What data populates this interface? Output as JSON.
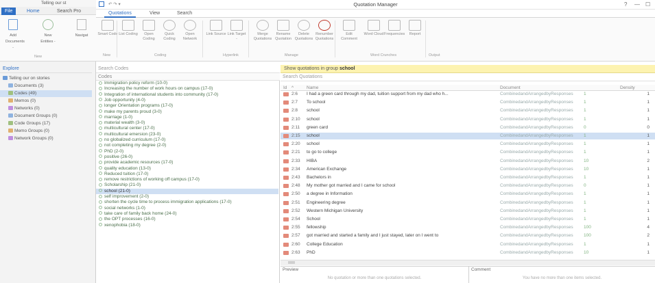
{
  "background_app": {
    "tab_label": "Telling our st",
    "tabs": [
      "File",
      "Home",
      "Search Pro"
    ],
    "ribbon_buttons": [
      "Add Documents -",
      "New Entities -",
      "Navigat"
    ],
    "ribbon_group": "New",
    "explore_title": "Explore",
    "tree": [
      {
        "label": "Telling our on stories",
        "level": 0,
        "color": "#6a9bd8"
      },
      {
        "label": "Documents (3)",
        "level": 1,
        "color": "#8fb3e0"
      },
      {
        "label": "Codes (49)",
        "level": 1,
        "color": "#a0c080",
        "selected": true
      },
      {
        "label": "Memos (0)",
        "level": 1,
        "color": "#e0b070"
      },
      {
        "label": "Networks (0)",
        "level": 1,
        "color": "#c08fe0"
      },
      {
        "label": "Document Groups (0)",
        "level": 1,
        "color": "#8fb3e0"
      },
      {
        "label": "Code Groups (17)",
        "level": 1,
        "color": "#a0c080"
      },
      {
        "label": "Memo Groups (0)",
        "level": 1,
        "color": "#e0b070"
      },
      {
        "label": "Network Groups (0)",
        "level": 1,
        "color": "#c08fe0"
      }
    ]
  },
  "window": {
    "title": "Quotation Manager",
    "controls": [
      "?",
      "—",
      "☐"
    ]
  },
  "tabs": [
    "Quotations",
    "View",
    "Search"
  ],
  "ribbon": {
    "buttons": [
      {
        "label": "Smart Code",
        "icon": "smart-code-icon"
      },
      {
        "label": "List Coding",
        "icon": "list-coding-icon"
      },
      {
        "label": "Open Coding",
        "icon": "open-coding-icon"
      },
      {
        "label": "Quick Coding",
        "icon": "quick-coding-icon"
      },
      {
        "label": "Open Network",
        "icon": "network-icon"
      },
      {
        "label": "Link Source",
        "icon": "link-source-icon"
      },
      {
        "label": "Link Target -",
        "icon": "link-target-icon"
      },
      {
        "label": "Merge Quotations",
        "icon": "merge-icon"
      },
      {
        "label": "Rename Quotation",
        "icon": "rename-icon"
      },
      {
        "label": "Delete Quotations",
        "icon": "delete-icon"
      },
      {
        "label": "Renumber Quotations",
        "icon": "renumber-icon"
      },
      {
        "label": "Edit Comment",
        "icon": "edit-comment-icon"
      },
      {
        "label": "Word Cloud",
        "icon": "word-cloud-icon"
      },
      {
        "label": "Frequencies",
        "icon": "frequencies-icon"
      },
      {
        "label": "Report",
        "icon": "report-icon"
      }
    ],
    "groups": [
      "New",
      "Coding",
      "Hyperlink",
      "Manage",
      "Word Crunches",
      "Output"
    ]
  },
  "codes": {
    "search_placeholder": "Search Codes",
    "header": "Codes",
    "items": [
      {
        "label": "Immigration policy reform (10-0)"
      },
      {
        "label": "Increasing the number of work hours on campus (17-0)"
      },
      {
        "label": "Integration of international students into community (17-0)"
      },
      {
        "label": "Job opportunity (4-0)"
      },
      {
        "label": "longer Orientation programs (17-0)"
      },
      {
        "label": "make my parents proud (3-0)"
      },
      {
        "label": "marriage (1-0)"
      },
      {
        "label": "material wealth (3-0)"
      },
      {
        "label": "multicultural center (17-0)"
      },
      {
        "label": "multicultural emersion (23-0)"
      },
      {
        "label": "no globalized curriculum (17-0)"
      },
      {
        "label": "not completing my degree (2-0)"
      },
      {
        "label": "PhD (2-0)"
      },
      {
        "label": "positive (26-0)"
      },
      {
        "label": "provide academic resources (17-0)"
      },
      {
        "label": "quality education (13-0)"
      },
      {
        "label": "Reduced tuition (17-0)"
      },
      {
        "label": "remove restrictions of working off campus (17-0)"
      },
      {
        "label": "Scholarship (21-0)"
      },
      {
        "label": "school (21-0)",
        "selected": true
      },
      {
        "label": "self improvement (2-0)"
      },
      {
        "label": "shorten the cycle time to process immigration applications (17-0)"
      },
      {
        "label": "social networks (1-0)"
      },
      {
        "label": "take care of family back home (24-0)"
      },
      {
        "label": "the OPT processes (16-0)"
      },
      {
        "label": "xenophobia (18-0)"
      }
    ]
  },
  "quotations": {
    "filter_text": "Show quotations in group",
    "filter_group": "school",
    "search_placeholder": "Search Quotations",
    "columns": [
      "Id",
      "Name",
      "Document",
      "Density"
    ],
    "rows": [
      {
        "id": "2:6",
        "name": "I had a green card through my dad, tuition support from my dad who h...",
        "document": "CombinedandArrangedbyResponses",
        "g": "1",
        "density": "1"
      },
      {
        "id": "2:7",
        "name": "To school",
        "document": "CombinedandArrangedbyResponses",
        "g": "1",
        "density": "1"
      },
      {
        "id": "2:8",
        "name": "school",
        "document": "CombinedandArrangedbyResponses",
        "g": "1",
        "density": "1"
      },
      {
        "id": "2:10",
        "name": "school",
        "document": "CombinedandArrangedbyResponses",
        "g": "1",
        "density": "1"
      },
      {
        "id": "2:11",
        "name": "green card",
        "document": "CombinedandArrangedbyResponses",
        "g": "0",
        "density": "0"
      },
      {
        "id": "2:15",
        "name": "school",
        "document": "CombinedandArrangedbyResponses",
        "g": "1",
        "density": "1",
        "selected": true
      },
      {
        "id": "2:20",
        "name": "school",
        "document": "CombinedandArrangedbyResponses",
        "g": "1",
        "density": "1"
      },
      {
        "id": "2:21",
        "name": "to go to college",
        "document": "CombinedandArrangedbyResponses",
        "g": "1",
        "density": "1"
      },
      {
        "id": "2:33",
        "name": "HIBA",
        "document": "CombinedandArrangedbyResponses",
        "g": "10",
        "density": "2"
      },
      {
        "id": "2:34",
        "name": "American Exchange",
        "document": "CombinedandArrangedbyResponses",
        "g": "10",
        "density": "1"
      },
      {
        "id": "2:43",
        "name": "Bachelors in",
        "document": "CombinedandArrangedbyResponses",
        "g": "1",
        "density": "1"
      },
      {
        "id": "2:48",
        "name": "My mother got married and I came for school",
        "document": "CombinedandArrangedbyResponses",
        "g": "0",
        "density": "1"
      },
      {
        "id": "2:50",
        "name": "a degree in Information",
        "document": "CombinedandArrangedbyResponses",
        "g": "1",
        "density": "1"
      },
      {
        "id": "2:51",
        "name": "Engineering degree",
        "document": "CombinedandArrangedbyResponses",
        "g": "1",
        "density": "1"
      },
      {
        "id": "2:52",
        "name": "Western Michigan University",
        "document": "CombinedandArrangedbyResponses",
        "g": "1",
        "density": "1"
      },
      {
        "id": "2:54",
        "name": "School",
        "document": "CombinedandArrangedbyResponses",
        "g": "1",
        "density": "1"
      },
      {
        "id": "2:55",
        "name": "fellowship",
        "document": "CombinedandArrangedbyResponses",
        "g": "100",
        "density": "4"
      },
      {
        "id": "2:57",
        "name": "got married and started a family and I just stayed, later on I went to",
        "document": "CombinedandArrangedbyResponses",
        "g": "100",
        "density": "2"
      },
      {
        "id": "2:60",
        "name": "College Education",
        "document": "CombinedandArrangedbyResponses",
        "g": "1",
        "density": "1"
      },
      {
        "id": "2:63",
        "name": "PhD",
        "document": "CombinedandArrangedbyResponses",
        "g": "10",
        "density": "1"
      }
    ]
  },
  "preview": {
    "title": "Preview",
    "message": "No quotation or more than one quotations selected."
  },
  "comment": {
    "title": "Comment",
    "message": "You have no more than one items selected."
  }
}
